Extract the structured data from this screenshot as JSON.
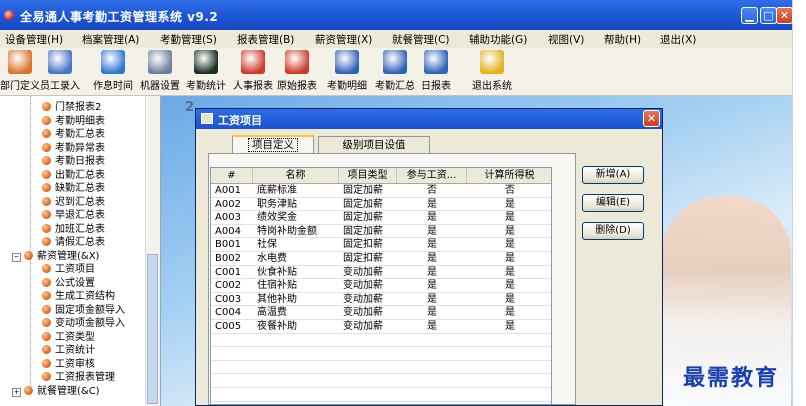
{
  "window": {
    "title": "全易通人事考勤工资管理系统 v9.2",
    "minimize": "▁",
    "maximize": "□",
    "close": "✕"
  },
  "menu": [
    "设备管理(H)",
    "档案管理(A)",
    "考勤管理(S)",
    "报表管理(B)",
    "薪资管理(X)",
    "就餐管理(C)",
    "辅助功能(G)",
    "视图(V)",
    "帮助(H)",
    "退出(X)"
  ],
  "toolbar": [
    {
      "label": "部门定义",
      "icon": "people-group-icon",
      "color": "#d8742c"
    },
    {
      "label": "员工录入",
      "icon": "employee-card-icon",
      "color": "#4a74c9"
    },
    {
      "label": "作息时间",
      "icon": "globe-clock-icon",
      "color": "#2f78d0"
    },
    {
      "label": "机器设置",
      "icon": "computer-icon",
      "color": "#6b7f9e"
    },
    {
      "label": "考勤统计",
      "icon": "waveform-monitor-icon",
      "color": "#1b2f25"
    },
    {
      "label": "人事报表",
      "icon": "letter-a-report-icon",
      "color": "#d03a2a"
    },
    {
      "label": "原始报表",
      "icon": "letter-a-report-icon",
      "color": "#d03a2a"
    },
    {
      "label": "考勤明细",
      "icon": "letter-t-report-icon",
      "color": "#2f63b8"
    },
    {
      "label": "考勤汇总",
      "icon": "letter-t-report-icon",
      "color": "#2f63b8"
    },
    {
      "label": "日报表",
      "icon": "letter-t-report-icon",
      "color": "#2f63b8"
    },
    {
      "label": "退出系统",
      "icon": "running-man-exit-icon",
      "color": "#e2b21c"
    }
  ],
  "tree": {
    "items": [
      {
        "label": "门禁报表2",
        "kind": "leaf"
      },
      {
        "label": "考勤明细表",
        "kind": "leaf"
      },
      {
        "label": "考勤汇总表",
        "kind": "leaf"
      },
      {
        "label": "考勤异常表",
        "kind": "leaf"
      },
      {
        "label": "考勤日报表",
        "kind": "leaf"
      },
      {
        "label": "出勤汇总表",
        "kind": "leaf"
      },
      {
        "label": "缺勤汇总表",
        "kind": "leaf"
      },
      {
        "label": "迟到汇总表",
        "kind": "leaf"
      },
      {
        "label": "早退汇总表",
        "kind": "leaf"
      },
      {
        "label": "加班汇总表",
        "kind": "leaf"
      },
      {
        "label": "请假汇总表",
        "kind": "leaf"
      },
      {
        "label": "薪资管理(&X)",
        "kind": "group",
        "toggle": "−"
      },
      {
        "label": "工资项目",
        "kind": "leaf"
      },
      {
        "label": "公式设置",
        "kind": "leaf"
      },
      {
        "label": "生成工资结构",
        "kind": "leaf"
      },
      {
        "label": "固定项金额导入",
        "kind": "leaf"
      },
      {
        "label": "变动项金额导入",
        "kind": "leaf"
      },
      {
        "label": "工资类型",
        "kind": "leaf"
      },
      {
        "label": "工资统计",
        "kind": "leaf"
      },
      {
        "label": "工资审核",
        "kind": "leaf"
      },
      {
        "label": "工资报表管理",
        "kind": "leaf"
      },
      {
        "label": "就餐管理(&C)",
        "kind": "group",
        "toggle": "+"
      }
    ]
  },
  "mdi": {
    "number": "2"
  },
  "dialog": {
    "title": "工资项目",
    "close": "✕",
    "tabs": [
      "项目定义",
      "级别项目设值"
    ],
    "columns": [
      "#",
      "名称",
      "项目类型",
      "参与工资...",
      "计算所得税"
    ],
    "rows": [
      [
        "A001",
        "底薪标准",
        "固定加薪",
        "否",
        "否"
      ],
      [
        "A002",
        "职务津贴",
        "固定加薪",
        "是",
        "是"
      ],
      [
        "A003",
        "绩效奖金",
        "固定加薪",
        "是",
        "是"
      ],
      [
        "A004",
        "特岗补助金额",
        "固定加薪",
        "是",
        "是"
      ],
      [
        "B001",
        "社保",
        "固定扣薪",
        "是",
        "是"
      ],
      [
        "B002",
        "水电费",
        "固定扣薪",
        "是",
        "是"
      ],
      [
        "C001",
        "伙食补贴",
        "变动加薪",
        "是",
        "是"
      ],
      [
        "C002",
        "住宿补贴",
        "变动加薪",
        "是",
        "是"
      ],
      [
        "C003",
        "其他补助",
        "变动加薪",
        "是",
        "是"
      ],
      [
        "C004",
        "高温费",
        "变动加薪",
        "是",
        "是"
      ],
      [
        "C005",
        "夜餐补助",
        "变动加薪",
        "是",
        "是"
      ]
    ],
    "buttons": [
      "新增(A)",
      "编辑(E)",
      "删除(D)"
    ]
  },
  "watermark": "最需教育"
}
